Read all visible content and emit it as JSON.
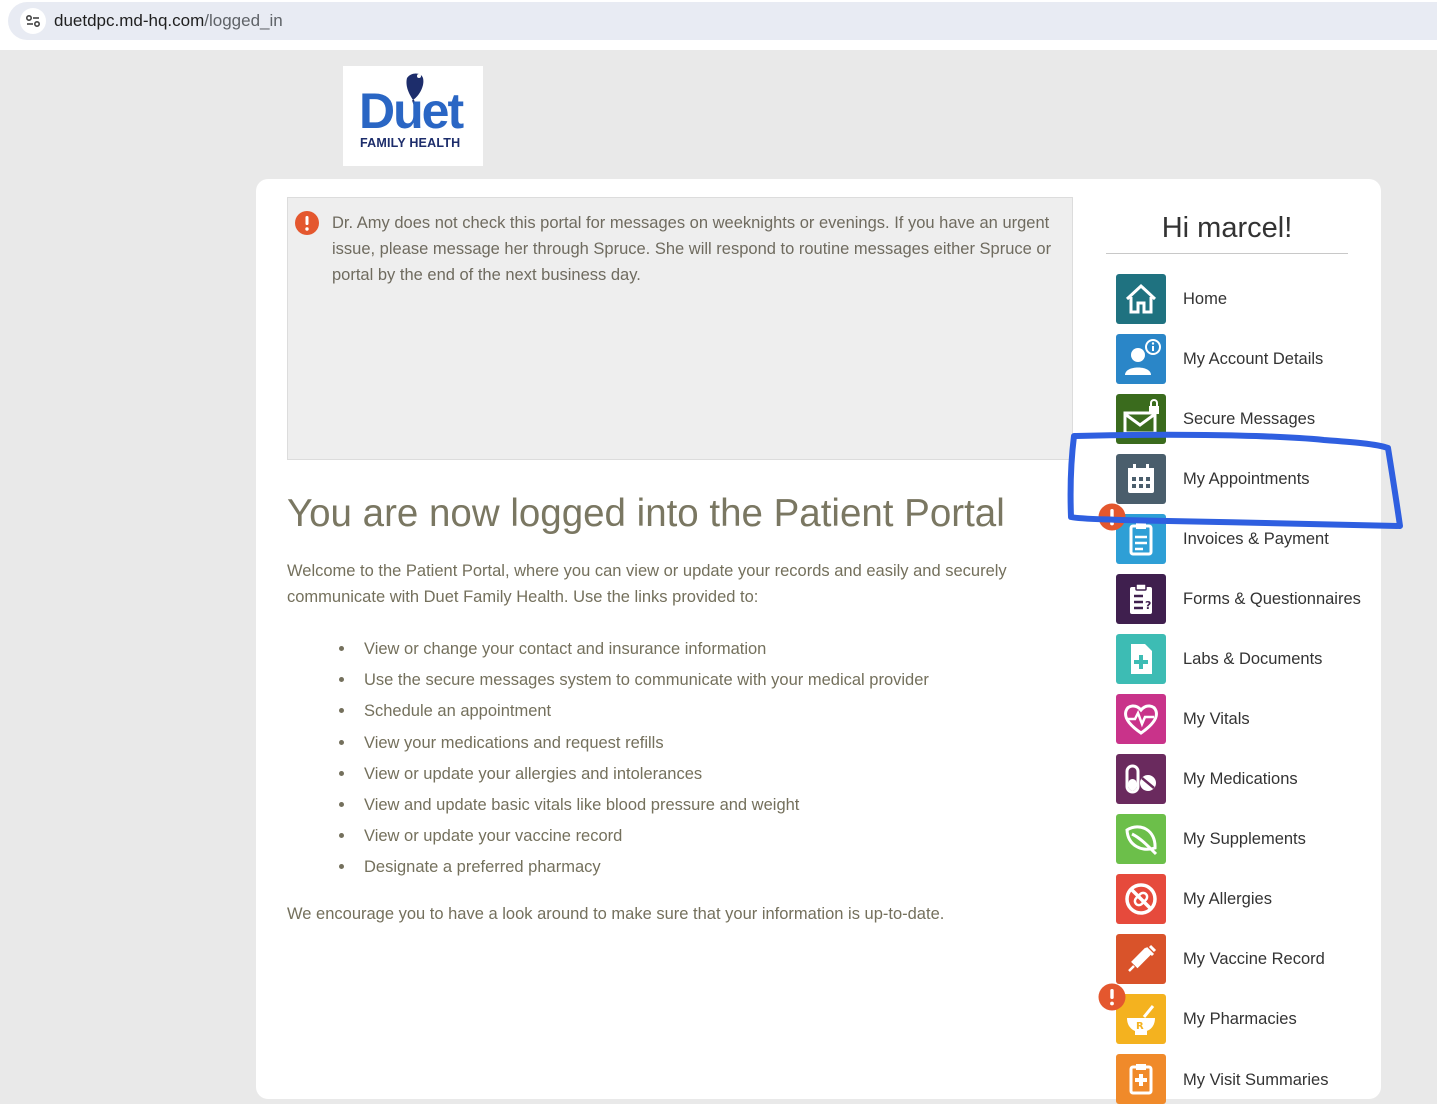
{
  "browser": {
    "url_domain": "duetdpc.md-hq.com",
    "url_path": "/logged_in"
  },
  "logo": {
    "word": "Duet",
    "tagline": "FAMILY HEALTH"
  },
  "notice": {
    "text": "Dr. Amy does not check this portal for messages on weeknights or evenings.  If you have an urgent issue, please message her through Spruce.  She will respond to routine messages either Spruce or portal by the end of the next business day."
  },
  "main": {
    "title": "You are now logged into the Patient Portal",
    "intro": "Welcome to the Patient Portal, where you can view or update your records and easily and securely communicate with Duet Family Health. Use the links provided to:",
    "bullets": [
      "View or change your contact and insurance information",
      "Use the secure messages system to communicate with your medical provider",
      "Schedule an appointment",
      "View your medications and request refills",
      "View or update your allergies and intolerances",
      "View and update basic vitals like blood pressure and weight",
      "View or update your vaccine record",
      "Designate a preferred pharmacy"
    ],
    "outro": "We encourage you to have a look around to make sure that your information is up-to-date."
  },
  "sidebar": {
    "greeting": "Hi marcel!",
    "items": [
      {
        "label": "Home",
        "icon": "home-icon",
        "color": "#1f7280"
      },
      {
        "label": "My Account Details",
        "icon": "account-info-icon",
        "color": "#2a86c8"
      },
      {
        "label": "Secure Messages",
        "icon": "secure-envelope-icon",
        "color": "#3a6b1d"
      },
      {
        "label": "My Appointments",
        "icon": "calendar-icon",
        "color": "#4a5e6c"
      },
      {
        "label": "Invoices & Payment",
        "icon": "invoice-icon",
        "color": "#2e9fd6"
      },
      {
        "label": "Forms & Questionnaires",
        "icon": "clipboard-question-icon",
        "color": "#3f1f4e"
      },
      {
        "label": "Labs & Documents",
        "icon": "document-plus-icon",
        "color": "#3dbcb4"
      },
      {
        "label": "My Vitals",
        "icon": "heartbeat-icon",
        "color": "#c9338a"
      },
      {
        "label": "My Medications",
        "icon": "pills-icon",
        "color": "#6a2a5e"
      },
      {
        "label": "My Supplements",
        "icon": "leaf-icon",
        "color": "#6cbf4a"
      },
      {
        "label": "My Allergies",
        "icon": "allergy-block-icon",
        "color": "#e64a3c"
      },
      {
        "label": "My Vaccine Record",
        "icon": "syringe-icon",
        "color": "#d9532a"
      },
      {
        "label": "My Pharmacies",
        "icon": "mortar-pestle-icon",
        "color": "#f4b21f"
      },
      {
        "label": "My Visit Summaries",
        "icon": "visit-summary-icon",
        "color": "#f08a2a"
      }
    ]
  },
  "colors": {
    "alert": "#e4572e",
    "highlight_stroke": "#2f5fe0"
  }
}
